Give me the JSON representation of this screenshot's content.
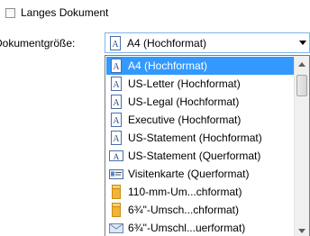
{
  "options": {
    "long_document_label": "Langes Dokument",
    "document_size_label": "Dokumentgröße:"
  },
  "combo": {
    "selected": "A4 (Hochformat)"
  },
  "list": {
    "items": [
      {
        "label": "A4 (Hochformat)",
        "icon": "portrait-page-icon",
        "selected": true
      },
      {
        "label": "US-Letter (Hochformat)",
        "icon": "portrait-page-icon"
      },
      {
        "label": "US-Legal (Hochformat)",
        "icon": "portrait-page-icon"
      },
      {
        "label": "Executive (Hochformat)",
        "icon": "portrait-page-icon"
      },
      {
        "label": "US-Statement (Hochformat)",
        "icon": "portrait-page-icon"
      },
      {
        "label": "US-Statement (Querformat)",
        "icon": "landscape-page-icon"
      },
      {
        "label": "Visitenkarte (Querformat)",
        "icon": "business-card-icon"
      },
      {
        "label": "110-mm-Um...chformat)",
        "icon": "envelope-icon"
      },
      {
        "label": "6¾\"-Umsch...chformat)",
        "icon": "envelope-icon"
      },
      {
        "label": "6¾\"-Umschl...uerformat)",
        "icon": "landscape-envelope-icon"
      }
    ]
  },
  "colors": {
    "selection": "#3399ff",
    "combo_border": "#7eb4ea"
  }
}
